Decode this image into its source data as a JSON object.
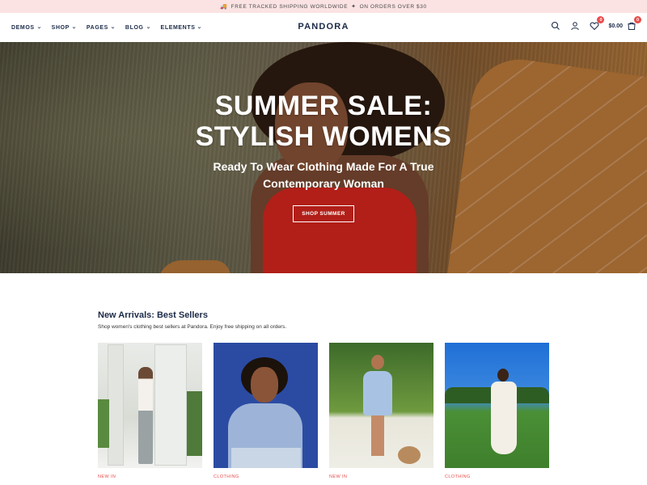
{
  "announcement": {
    "icon": "truck-emoji",
    "text_left": "FREE TRACKED SHIPPING WORLDWIDE",
    "icon2": "sparkle-emoji",
    "text_right": "ON ORDERS OVER $30"
  },
  "header": {
    "nav": [
      {
        "label": "DEMOS"
      },
      {
        "label": "SHOP"
      },
      {
        "label": "PAGES"
      },
      {
        "label": "BLOG"
      },
      {
        "label": "ELEMENTS"
      }
    ],
    "logo": "PANDORA",
    "wishlist_count": "0",
    "cart_total": "$0.00",
    "cart_count": "0"
  },
  "hero": {
    "title_line1": "SUMMER SALE:",
    "title_line2": "STYLISH WOMENS",
    "subtitle_line1": "Ready To Wear Clothing Made For A True",
    "subtitle_line2": "Contemporary Woman",
    "button": "SHOP SUMMER"
  },
  "section": {
    "title": "New Arrivals: Best Sellers",
    "description": "Shop women's clothing best sellers at Pandora. Enjoy free shipping on all orders."
  },
  "products": [
    {
      "tag": "NEW IN"
    },
    {
      "tag": "CLOTHING"
    },
    {
      "tag": "NEW IN"
    },
    {
      "tag": "CLOTHING"
    }
  ],
  "colors": {
    "accent": "#e94b4b",
    "navy": "#1b2a47",
    "announce_bg": "#fbe3e3"
  }
}
